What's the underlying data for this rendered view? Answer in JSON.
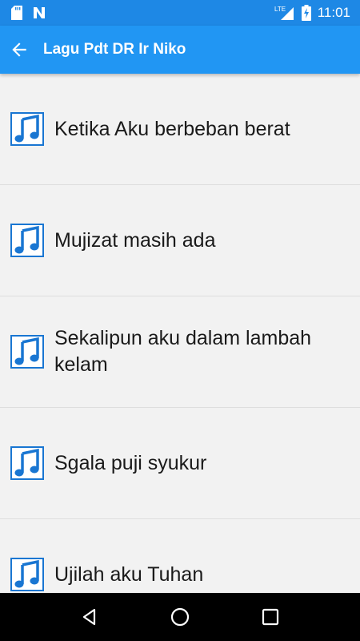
{
  "status_bar": {
    "time": "11:01",
    "network": "LTE",
    "icons": [
      "sd-card-icon",
      "n-notification-icon",
      "lte-signal-icon",
      "battery-charging-icon"
    ]
  },
  "app_bar": {
    "title": "Lagu Pdt DR Ir Niko",
    "background": "#2196f3",
    "status_background": "#1e88e5"
  },
  "songs": [
    {
      "label": "Ketika Aku berbeban berat",
      "icon": "music-note-icon"
    },
    {
      "label": "Mujizat masih ada",
      "icon": "music-note-icon"
    },
    {
      "label": "Sekalipun aku dalam lambah kelam",
      "icon": "music-note-icon"
    },
    {
      "label": "Sgala puji syukur",
      "icon": "music-note-icon"
    },
    {
      "label": "Ujilah aku Tuhan",
      "icon": "music-note-icon"
    }
  ],
  "nav_bar": {
    "buttons": [
      "back-nav-icon",
      "home-nav-icon",
      "recents-nav-icon"
    ]
  }
}
